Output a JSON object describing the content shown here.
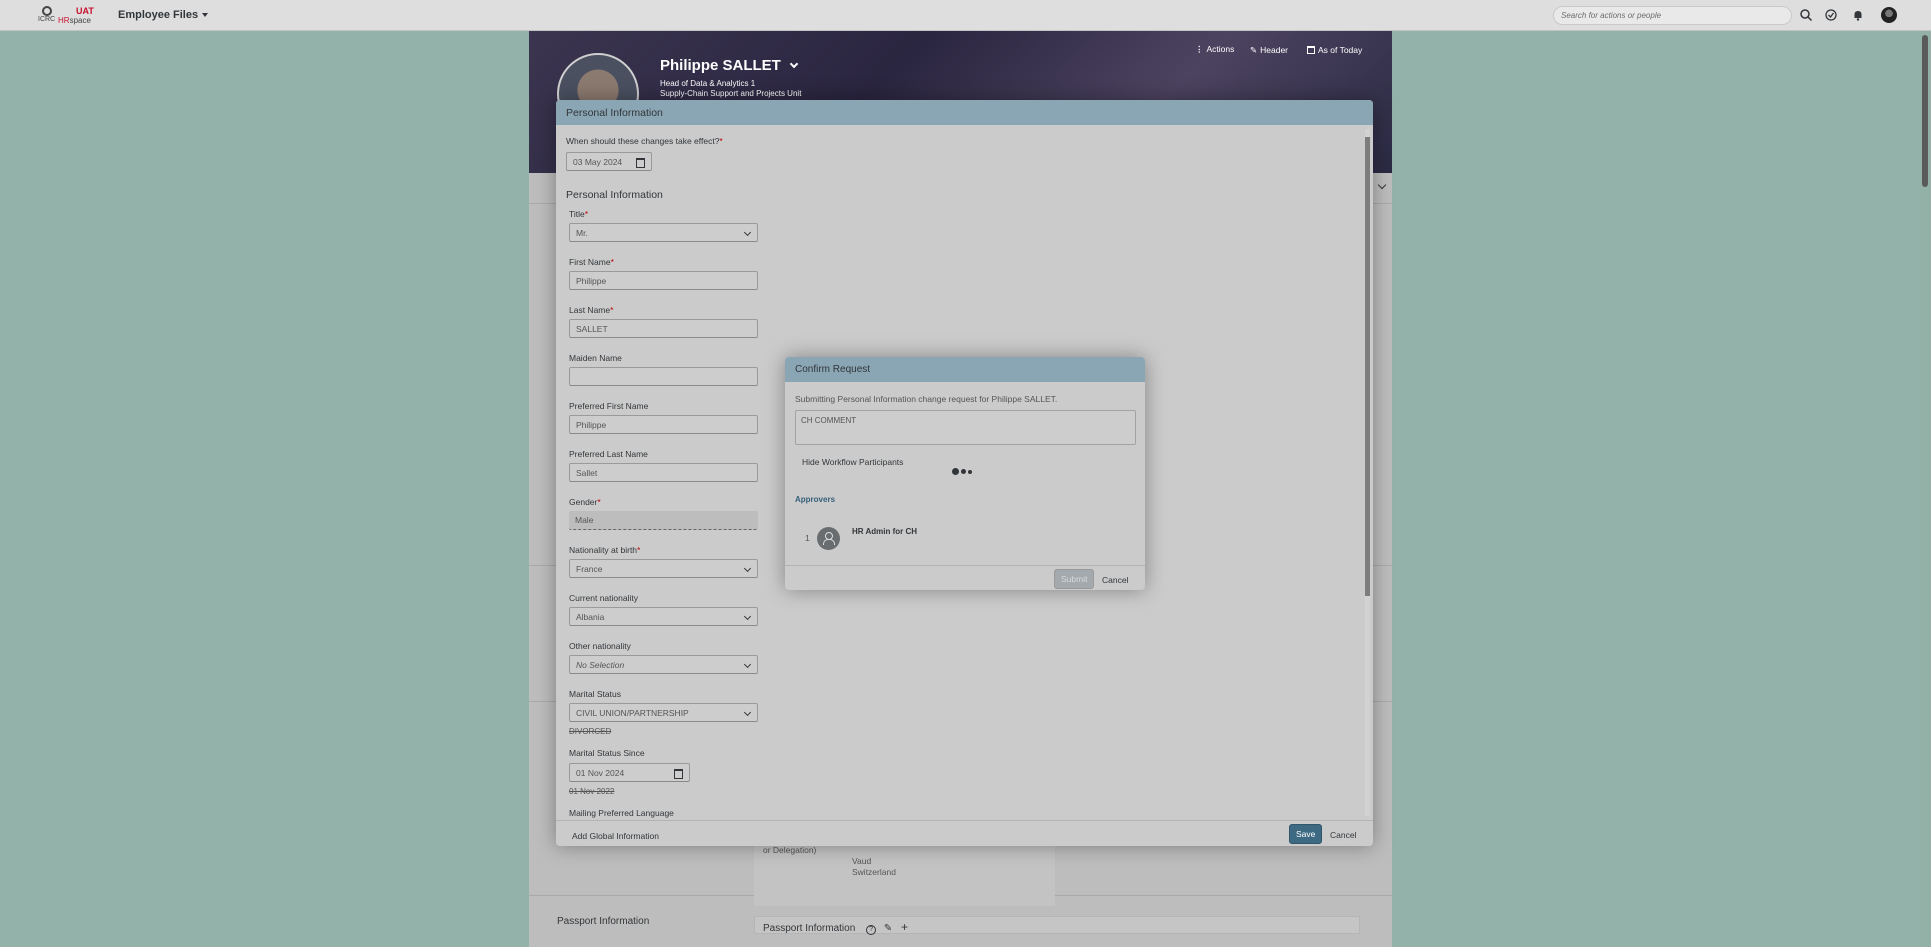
{
  "shell": {
    "logo_org": "ICRC",
    "logo_env": "UAT",
    "logo_app_prefix": "HR",
    "logo_app_suffix": "space",
    "menu_title": "Employee Files",
    "search_placeholder": "Search for actions or people"
  },
  "header": {
    "name": "Philippe SALLET",
    "position": "Head of Data & Analytics 1",
    "unit": "Supply-Chain Support and Projects Unit",
    "actions_label": "Actions",
    "header_label": "Header",
    "as_of_label": "As of Today"
  },
  "background": {
    "delegation_text": "or Delegation)",
    "location_line1": "Vaud",
    "location_line2": "Switzerland",
    "passport_label": "Passport Information",
    "passport_card_title": "Passport Information"
  },
  "personal_dialog": {
    "title": "Personal Information",
    "effective_label": "When should these changes take effect?",
    "effective_date": "03 May 2024",
    "section_title": "Personal Information",
    "fields": {
      "title": {
        "label": "Title",
        "value": "Mr."
      },
      "first_name": {
        "label": "First Name",
        "value": "Philippe"
      },
      "last_name": {
        "label": "Last Name",
        "value": "SALLET"
      },
      "maiden_name": {
        "label": "Maiden Name",
        "value": ""
      },
      "preferred_first": {
        "label": "Preferred First Name",
        "value": "Philippe"
      },
      "preferred_last": {
        "label": "Preferred Last Name",
        "value": "Sallet"
      },
      "gender": {
        "label": "Gender",
        "value": "Male"
      },
      "nationality_birth": {
        "label": "Nationality at birth",
        "value": "France"
      },
      "current_nationality": {
        "label": "Current nationality",
        "value": "Albania"
      },
      "other_nationality": {
        "label": "Other nationality",
        "value": "No Selection"
      },
      "marital_status": {
        "label": "Marital Status",
        "value": "CIVIL UNION/PARTNERSHIP",
        "old_value": "DIVORCED"
      },
      "marital_since": {
        "label": "Marital Status Since",
        "value": "01 Nov 2024",
        "old_value": "01 Nov 2022"
      },
      "mailing_language": {
        "label": "Mailing Preferred Language"
      }
    },
    "add_global_label": "Add Global Information",
    "save_label": "Save",
    "cancel_label": "Cancel"
  },
  "confirm_dialog": {
    "title": "Confirm Request",
    "message": "Submitting Personal Information change request for Philippe SALLET.",
    "comment": "CH COMMENT",
    "hide_participants_label": "Hide Workflow Participants",
    "approvers_title": "Approvers",
    "approvers": [
      {
        "index": "1",
        "name": "HR Admin for CH"
      }
    ],
    "submit_label": "Submit",
    "cancel_label": "Cancel"
  },
  "colors": {
    "backdrop": "#93b2a9",
    "dialog_header": "#8aa5b3",
    "accent_button": "#3d6a82",
    "required": "#bb0000"
  }
}
